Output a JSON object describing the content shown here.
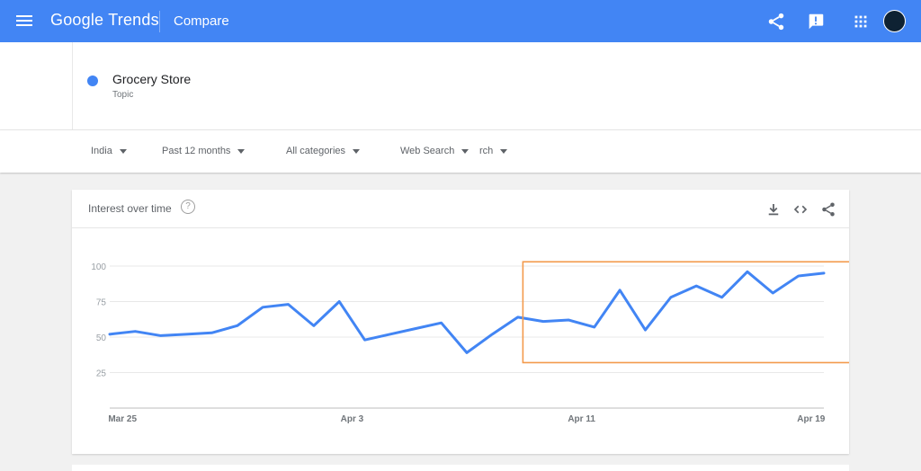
{
  "header": {
    "brand_google": "Google",
    "brand_trends": "Trends",
    "page_title": "Compare",
    "bar_color": "#4285f4"
  },
  "term": {
    "name": "Grocery Store",
    "type": "Topic",
    "color": "#4285f4"
  },
  "filters": {
    "region": "India",
    "time": "Past 12 months",
    "category": "All categories",
    "search_type": "Web Search",
    "extra": "rch"
  },
  "card": {
    "title": "Interest over time",
    "help_glyph": "?"
  },
  "chart_data": {
    "type": "line",
    "ylim": [
      0,
      100
    ],
    "y_ticks": [
      25,
      50,
      75,
      100
    ],
    "x_tick_labels": [
      "Mar 25",
      "Apr 3",
      "Apr 11",
      "Apr 19"
    ],
    "x_tick_positions": [
      0.5,
      9.5,
      18.5,
      27.5
    ],
    "grid": true,
    "series": [
      {
        "color": "#4285f4",
        "values": [
          52,
          54,
          51,
          52,
          53,
          58,
          71,
          73,
          58,
          75,
          48,
          52,
          56,
          60,
          39,
          52,
          64,
          61,
          62,
          57,
          83,
          55,
          78,
          86,
          78,
          96,
          81,
          93,
          95
        ]
      }
    ],
    "highlight": {
      "x_start": 16.2,
      "x_end": 29.2,
      "y_low": 32,
      "y_high": 103,
      "color": "#f39a4b"
    }
  }
}
